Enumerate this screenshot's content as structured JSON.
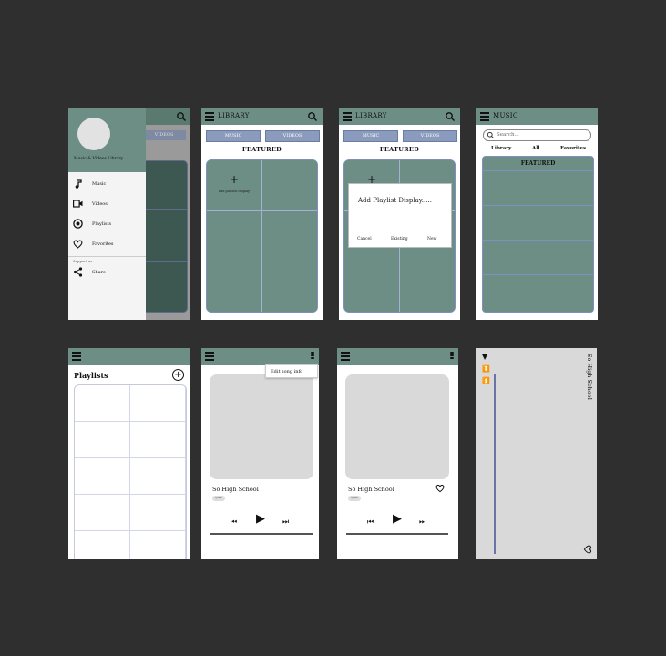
{
  "colors": {
    "accent": "#6c8e84",
    "tab": "#8a9bbd",
    "background": "#2f2f2f"
  },
  "screen1": {
    "drawer_title": "Music & Videos Library",
    "menu": [
      {
        "label": "Music",
        "icon": "music-note-icon"
      },
      {
        "label": "Videos",
        "icon": "video-icon"
      },
      {
        "label": "Playlists",
        "icon": "playlist-icon"
      },
      {
        "label": "Favorites",
        "icon": "heart-icon"
      }
    ],
    "support_label": "Support us",
    "share_label": "Share",
    "behind_tab": "VIDEOS"
  },
  "screen2": {
    "title": "LIBRARY",
    "tab_music": "MUSIC",
    "tab_videos": "VIDEOS",
    "featured": "FEATURED",
    "add_label": "add playlist display"
  },
  "screen3": {
    "title": "LIBRARY",
    "tab_music": "MUSIC",
    "tab_videos": "VIDEOS",
    "featured": "FEATURED",
    "dialog_title": "Add Playlist Display.....",
    "dialog_cancel": "Cancel",
    "dialog_existing": "Existing",
    "dialog_new": "New"
  },
  "screen4": {
    "title": "MUSIC",
    "search_placeholder": "Search...",
    "tabs": [
      "Library",
      "All",
      "Favorites"
    ],
    "featured": "FEATURED"
  },
  "screen5": {
    "title": "Playlists"
  },
  "screen6": {
    "menu_item": "Edit song info",
    "song": "So High School",
    "tag": "lyrics"
  },
  "screen7": {
    "song": "So High School",
    "tag": "lyrics"
  },
  "screen8": {
    "song": "So High School"
  }
}
